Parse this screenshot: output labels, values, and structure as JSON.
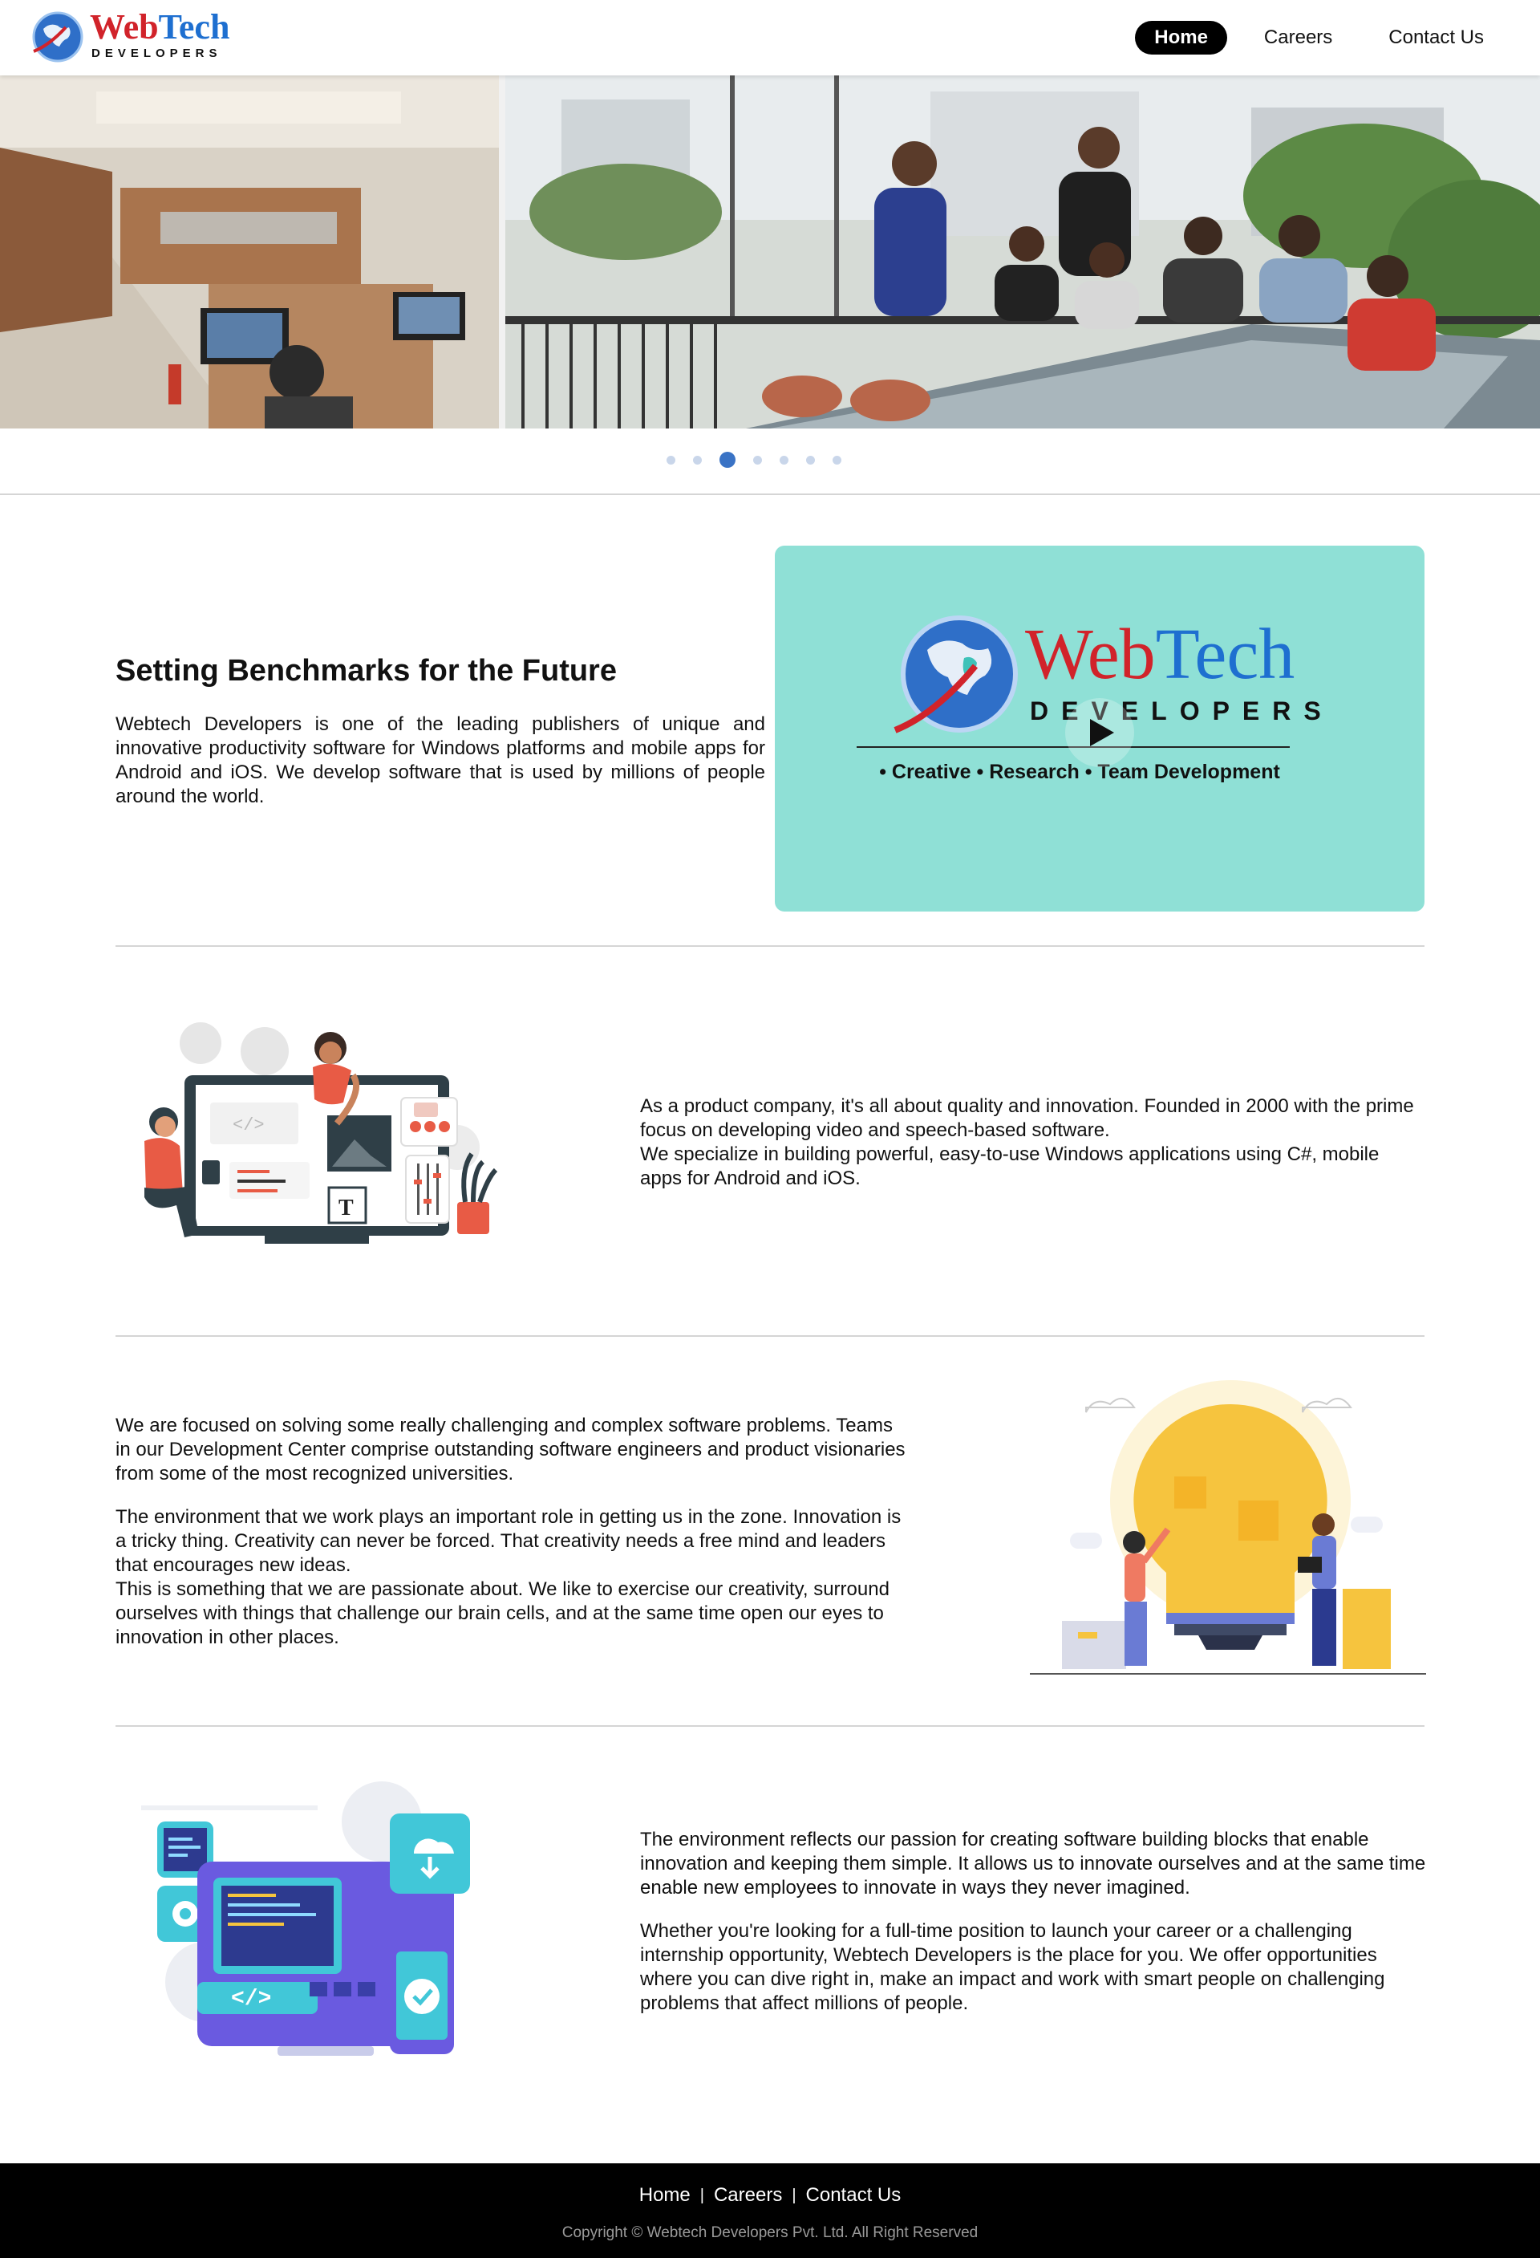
{
  "brand": {
    "logo_word_1": "Web",
    "logo_word_2": "Tech",
    "logo_sub": "DEVELOPERS"
  },
  "nav": {
    "home": "Home",
    "careers": "Careers",
    "contact": "Contact Us",
    "active": "Home"
  },
  "carousel": {
    "slide_count": 7,
    "active_index": 2
  },
  "intro": {
    "title": "Setting Benchmarks for the Future",
    "text": "Webtech Developers is one of the leading publishers of unique and innovative productivity software for Windows platforms and mobile apps for Android and iOS. We develop software that is used by millions of people around the world."
  },
  "video": {
    "word_1": "Web",
    "word_2": "Tech",
    "sub": "DEVELOPERS",
    "tagline": "• Creative • Research • Team Development"
  },
  "product": {
    "line1": "As a product company, it's all about quality and innovation. Founded in 2000 with the prime focus on developing video and speech-based software.",
    "line2": "We specialize in building powerful, easy-to-use Windows applications using C#, mobile apps for Android and iOS."
  },
  "focus": {
    "p1": "We are focused on solving some really challenging and complex software problems. Teams in our Development Center comprise outstanding software engineers and product visionaries from some of the most recognized universities.",
    "p2a": "The environment that we work plays an important role in getting us in the zone. Innovation is a tricky thing. Creativity can never be forced. That creativity needs a free mind and leaders that encourages new ideas.",
    "p2b": "This is something that we are passionate about. We like to exercise our creativity, surround ourselves with things that challenge our brain cells, and at the same time open our eyes to innovation in other places."
  },
  "environment": {
    "p1": "The environment reflects our passion for creating software building blocks that enable innovation and keeping them simple. It allows us to innovate ourselves and at the same time enable new employees to innovate in ways they never imagined.",
    "p2": "Whether you're looking for a full-time position to launch your career or a challenging internship opportunity, Webtech Developers is the place for you. We offer opportunities where you can dive right in, make an impact and work with smart people on challenging problems that affect millions of people."
  },
  "footer": {
    "home": "Home",
    "careers": "Careers",
    "contact": "Contact Us",
    "copyright": "Copyright © Webtech Developers Pvt. Ltd. All Right Reserved"
  },
  "colors": {
    "brand_red": "#d1232a",
    "brand_blue": "#1e6fd0",
    "dot_active": "#3a73c5",
    "dot_inactive": "#c9d6ea",
    "video_bg": "#8fe0d6"
  }
}
